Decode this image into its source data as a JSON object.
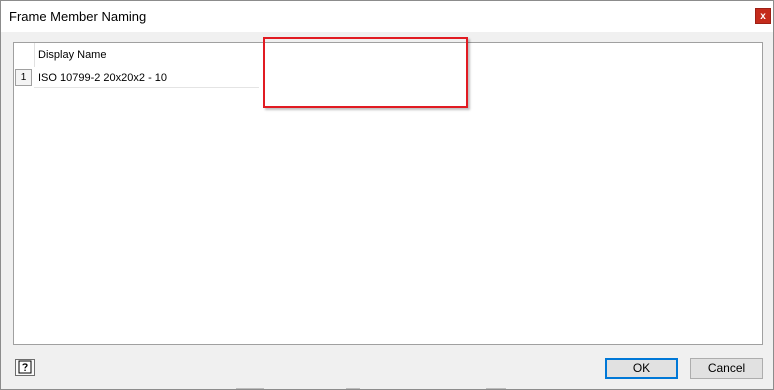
{
  "window": {
    "title": "Frame Member Naming",
    "close_label": "x"
  },
  "grid": {
    "columns": [
      "Display Name"
    ],
    "rows": [
      {
        "number": "1",
        "display_name": "ISO 10799-2 20x20x2 - 10"
      }
    ]
  },
  "footer": {
    "help_icon": "help-question-icon",
    "ok_label": "OK",
    "cancel_label": "Cancel"
  },
  "colors": {
    "highlight": "#e11b22",
    "focus_border": "#0078d7",
    "close_button": "#c42b1c"
  }
}
